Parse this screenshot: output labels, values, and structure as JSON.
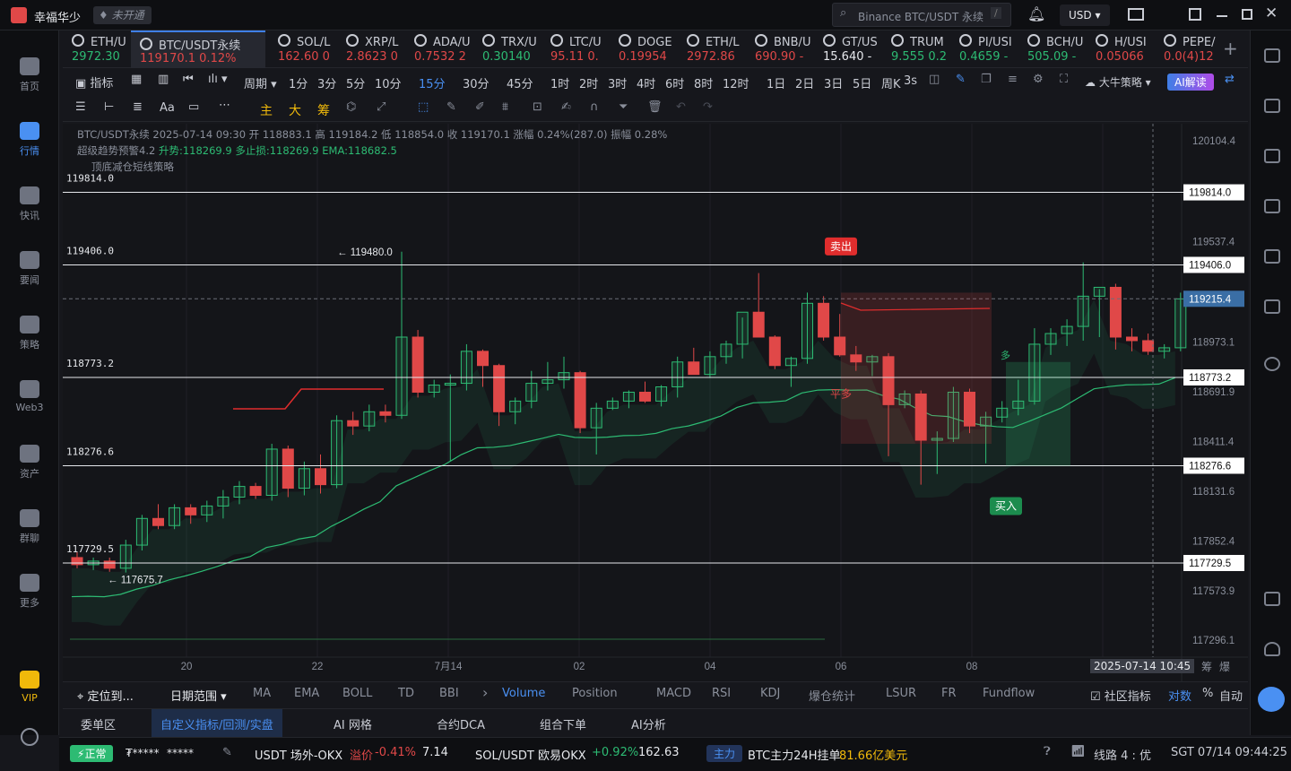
{
  "app": {
    "title": "幸福华少",
    "badge": "未开通",
    "search_placeholder": "Binance BTC/USDT 永续",
    "search_hint": "/",
    "currency": "USD"
  },
  "sidebar": [
    {
      "label": "首页"
    },
    {
      "label": "行情"
    },
    {
      "label": "快讯"
    },
    {
      "label": "要闻"
    },
    {
      "label": "策略"
    },
    {
      "label": "Web3"
    },
    {
      "label": "资产"
    },
    {
      "label": "群聊"
    },
    {
      "label": "更多"
    },
    {
      "label": "VIP"
    }
  ],
  "tickers": [
    {
      "sym": "ETH/U",
      "price": "2972.30",
      "color": "green"
    },
    {
      "sym": "BTC/USDT永续",
      "price": "119170.1 0.12%",
      "color": "red",
      "active": true
    },
    {
      "sym": "SOL/L",
      "price": "162.60 0",
      "color": "red"
    },
    {
      "sym": "XRP/L",
      "price": "2.8623 0",
      "color": "red"
    },
    {
      "sym": "ADA/U",
      "price": "0.7532 2",
      "color": "red"
    },
    {
      "sym": "TRX/U",
      "price": "0.30140",
      "color": "green"
    },
    {
      "sym": "LTC/U",
      "price": "95.11 0.",
      "color": "red"
    },
    {
      "sym": "DOGE",
      "price": "0.19954",
      "color": "red"
    },
    {
      "sym": "ETH/L",
      "price": "2972.86",
      "color": "red"
    },
    {
      "sym": "BNB/U",
      "price": "690.90 -",
      "color": "red"
    },
    {
      "sym": "GT/US",
      "price": "15.640 -",
      "color": "white"
    },
    {
      "sym": "TRUM",
      "price": "9.555 0.2",
      "color": "green"
    },
    {
      "sym": "PI/USI",
      "price": "0.4659 -",
      "color": "green"
    },
    {
      "sym": "BCH/U",
      "price": "505.09 -",
      "color": "green"
    },
    {
      "sym": "H/USI",
      "price": "0.05066",
      "color": "red"
    },
    {
      "sym": "PEPE/",
      "price": "0.0(4)12",
      "color": "red"
    }
  ],
  "periods": {
    "indicator": "指标",
    "period": "周期",
    "list": [
      "1分",
      "3分",
      "5分",
      "10分",
      "15分",
      "30分",
      "45分",
      "1时",
      "2时",
      "3时",
      "4时",
      "6时",
      "8时",
      "12时",
      "1日",
      "2日",
      "3日",
      "5日",
      "周K"
    ],
    "active": "15分",
    "refresh": "3s",
    "strategy": "大牛策略",
    "ai": "AI解读"
  },
  "toolbar_glyphs": [
    "主",
    "大",
    "筹"
  ],
  "info": {
    "line1": "BTC/USDT永续 2025-07-14 09:30 开 118883.1 高 119184.2 低 118854.0 收 119170.1 涨幅 0.24%(287.0) 振幅 0.28%",
    "line2_name": "超级趋势预警4.2",
    "line2_vals": "升势:118269.9 多止损:118269.9 EMA:118682.5",
    "line3": "顶底减仓短线策略"
  },
  "price_axis": [
    "120104.4",
    "119537.4",
    "118973.1",
    "118691.9",
    "118411.4",
    "118131.6",
    "117852.4",
    "117573.9",
    "117296.1"
  ],
  "hlines": [
    {
      "left": "119814.0",
      "right": "119814.0",
      "value": 119814.0
    },
    {
      "left": "119406.0",
      "right": "119406.0",
      "value": 119406.0
    },
    {
      "left": "118773.2",
      "right": "118773.2",
      "value": 118773.2
    },
    {
      "left": "118276.6",
      "right": "118276.6",
      "value": 118276.6
    },
    {
      "left": "117729.5",
      "right": "117729.5",
      "value": 117729.5
    }
  ],
  "current_price": "119215.4",
  "annotations": {
    "high": "← 119480.0",
    "low": "← 117675.7",
    "sell": "卖出",
    "close_long": "平多",
    "buy": "买入",
    "long": "多"
  },
  "time_axis": [
    "20",
    "22",
    "7月14",
    "02",
    "04",
    "06",
    "08"
  ],
  "crosshair_time": "2025-07-14 10:45",
  "axis_corner": [
    "筹",
    "爆"
  ],
  "indicator_tabs": {
    "left": [
      "定位到...",
      "日期范围"
    ],
    "list": [
      "MA",
      "EMA",
      "BOLL",
      "TD",
      "BBI",
      "Volume",
      "Position",
      "MACD",
      "RSI",
      "KDJ",
      "爆仓统计",
      "LSUR",
      "FR",
      "Fundflow"
    ],
    "active": "Volume",
    "right": [
      "社区指标",
      "对数",
      "%",
      "自动"
    ]
  },
  "bottom_tabs": [
    "委单区",
    "自定义指标/回测/实盘",
    "AI 网格",
    "合约DCA",
    "组合下单",
    "AI分析"
  ],
  "bottom_active": "自定义指标/回测/实盘",
  "status": {
    "state": "正常",
    "masked1": "₮*****",
    "masked2": "*****",
    "usdt": "USDT 场外-OKX",
    "premium_label": "溢价",
    "premium": "-0.41%",
    "usdt_price": "7.14",
    "sol": "SOL/USDT 欧易OKX",
    "sol_chg": "+0.92%",
    "sol_price": "162.63",
    "main_tag": "主力",
    "btc_main": "BTC主力24H挂单",
    "btc_main_val": "81.66亿美元",
    "line": "线路 4 : 优",
    "time": "SGT 07/14 09:44:25"
  },
  "chart_data": {
    "type": "candlestick",
    "x_labels": [
      "20",
      "22",
      "7月14",
      "02",
      "04",
      "06",
      "08"
    ],
    "ylim": [
      117200,
      120200
    ],
    "candles": [
      {
        "o": 117760,
        "h": 117790,
        "l": 117700,
        "c": 117720
      },
      {
        "o": 117720,
        "h": 117760,
        "l": 117690,
        "c": 117740
      },
      {
        "o": 117740,
        "h": 117760,
        "l": 117680,
        "c": 117700
      },
      {
        "o": 117700,
        "h": 117860,
        "l": 117676,
        "c": 117830
      },
      {
        "o": 117830,
        "h": 118000,
        "l": 117800,
        "c": 117980
      },
      {
        "o": 117980,
        "h": 118060,
        "l": 117920,
        "c": 117940
      },
      {
        "o": 117940,
        "h": 118060,
        "l": 117920,
        "c": 118040
      },
      {
        "o": 118040,
        "h": 118060,
        "l": 117950,
        "c": 118000
      },
      {
        "o": 118000,
        "h": 118080,
        "l": 117960,
        "c": 118050
      },
      {
        "o": 118050,
        "h": 118140,
        "l": 117980,
        "c": 118100
      },
      {
        "o": 118100,
        "h": 118190,
        "l": 118060,
        "c": 118160
      },
      {
        "o": 118160,
        "h": 118180,
        "l": 118090,
        "c": 118110
      },
      {
        "o": 118110,
        "h": 118400,
        "l": 118080,
        "c": 118370
      },
      {
        "o": 118370,
        "h": 118390,
        "l": 118100,
        "c": 118150
      },
      {
        "o": 118150,
        "h": 118300,
        "l": 118110,
        "c": 118260
      },
      {
        "o": 118260,
        "h": 118340,
        "l": 118120,
        "c": 118170
      },
      {
        "o": 118170,
        "h": 118560,
        "l": 118150,
        "c": 118530
      },
      {
        "o": 118530,
        "h": 118580,
        "l": 118450,
        "c": 118500
      },
      {
        "o": 118500,
        "h": 118620,
        "l": 118470,
        "c": 118580
      },
      {
        "o": 118580,
        "h": 118620,
        "l": 118520,
        "c": 118560
      },
      {
        "o": 118560,
        "h": 119480,
        "l": 118540,
        "c": 119000
      },
      {
        "o": 119000,
        "h": 119040,
        "l": 118660,
        "c": 118690
      },
      {
        "o": 118690,
        "h": 118760,
        "l": 118660,
        "c": 118730
      },
      {
        "o": 118730,
        "h": 118790,
        "l": 118300,
        "c": 118740
      },
      {
        "o": 118740,
        "h": 118960,
        "l": 118700,
        "c": 118920
      },
      {
        "o": 118920,
        "h": 118930,
        "l": 118720,
        "c": 118840
      },
      {
        "o": 118840,
        "h": 118850,
        "l": 118500,
        "c": 118580
      },
      {
        "o": 118580,
        "h": 118660,
        "l": 118510,
        "c": 118640
      },
      {
        "o": 118640,
        "h": 118810,
        "l": 118600,
        "c": 118740
      },
      {
        "o": 118740,
        "h": 118860,
        "l": 118700,
        "c": 118760
      },
      {
        "o": 118760,
        "h": 118890,
        "l": 118710,
        "c": 118800
      },
      {
        "o": 118800,
        "h": 118810,
        "l": 118460,
        "c": 118490
      },
      {
        "o": 118490,
        "h": 118630,
        "l": 118340,
        "c": 118600
      },
      {
        "o": 118600,
        "h": 118660,
        "l": 118590,
        "c": 118640
      },
      {
        "o": 118640,
        "h": 118700,
        "l": 118600,
        "c": 118690
      },
      {
        "o": 118690,
        "h": 118750,
        "l": 118630,
        "c": 118640
      },
      {
        "o": 118640,
        "h": 118730,
        "l": 118610,
        "c": 118720
      },
      {
        "o": 118720,
        "h": 118890,
        "l": 118660,
        "c": 118860
      },
      {
        "o": 118860,
        "h": 118940,
        "l": 118790,
        "c": 118790
      },
      {
        "o": 118790,
        "h": 118920,
        "l": 118770,
        "c": 118890
      },
      {
        "o": 118890,
        "h": 118980,
        "l": 118850,
        "c": 118960
      },
      {
        "o": 118960,
        "h": 119110,
        "l": 118880,
        "c": 119140
      },
      {
        "o": 119140,
        "h": 119360,
        "l": 119100,
        "c": 119000
      },
      {
        "o": 119000,
        "h": 119010,
        "l": 118820,
        "c": 118840
      },
      {
        "o": 118840,
        "h": 118890,
        "l": 118720,
        "c": 118880
      },
      {
        "o": 118880,
        "h": 119250,
        "l": 118850,
        "c": 119190
      },
      {
        "o": 119190,
        "h": 119230,
        "l": 118980,
        "c": 119000
      },
      {
        "o": 119000,
        "h": 119130,
        "l": 118890,
        "c": 118900
      },
      {
        "o": 118900,
        "h": 118950,
        "l": 118810,
        "c": 118860
      },
      {
        "o": 118860,
        "h": 118900,
        "l": 118780,
        "c": 118890
      },
      {
        "o": 118890,
        "h": 118910,
        "l": 118330,
        "c": 118620
      },
      {
        "o": 118620,
        "h": 118700,
        "l": 118600,
        "c": 118680
      },
      {
        "o": 118680,
        "h": 118700,
        "l": 118170,
        "c": 118420
      },
      {
        "o": 118420,
        "h": 118470,
        "l": 118230,
        "c": 118430
      },
      {
        "o": 118430,
        "h": 118720,
        "l": 118410,
        "c": 118690
      },
      {
        "o": 118690,
        "h": 118710,
        "l": 118460,
        "c": 118500
      },
      {
        "o": 118500,
        "h": 118580,
        "l": 118290,
        "c": 118550
      },
      {
        "o": 118550,
        "h": 118640,
        "l": 118520,
        "c": 118600
      },
      {
        "o": 118600,
        "h": 118760,
        "l": 118560,
        "c": 118640
      },
      {
        "o": 118640,
        "h": 119050,
        "l": 118620,
        "c": 118960
      },
      {
        "o": 118960,
        "h": 119050,
        "l": 118900,
        "c": 119020
      },
      {
        "o": 119020,
        "h": 119100,
        "l": 118950,
        "c": 119060
      },
      {
        "o": 119060,
        "h": 119420,
        "l": 118980,
        "c": 119230
      },
      {
        "o": 119230,
        "h": 119270,
        "l": 119000,
        "c": 119280
      },
      {
        "o": 119280,
        "h": 119300,
        "l": 118930,
        "c": 119000
      },
      {
        "o": 119000,
        "h": 119050,
        "l": 118920,
        "c": 118980
      },
      {
        "o": 118980,
        "h": 119020,
        "l": 118900,
        "c": 118920
      },
      {
        "o": 118920,
        "h": 118960,
        "l": 118880,
        "c": 118940
      },
      {
        "o": 118940,
        "h": 119250,
        "l": 118920,
        "c": 119215
      }
    ]
  }
}
